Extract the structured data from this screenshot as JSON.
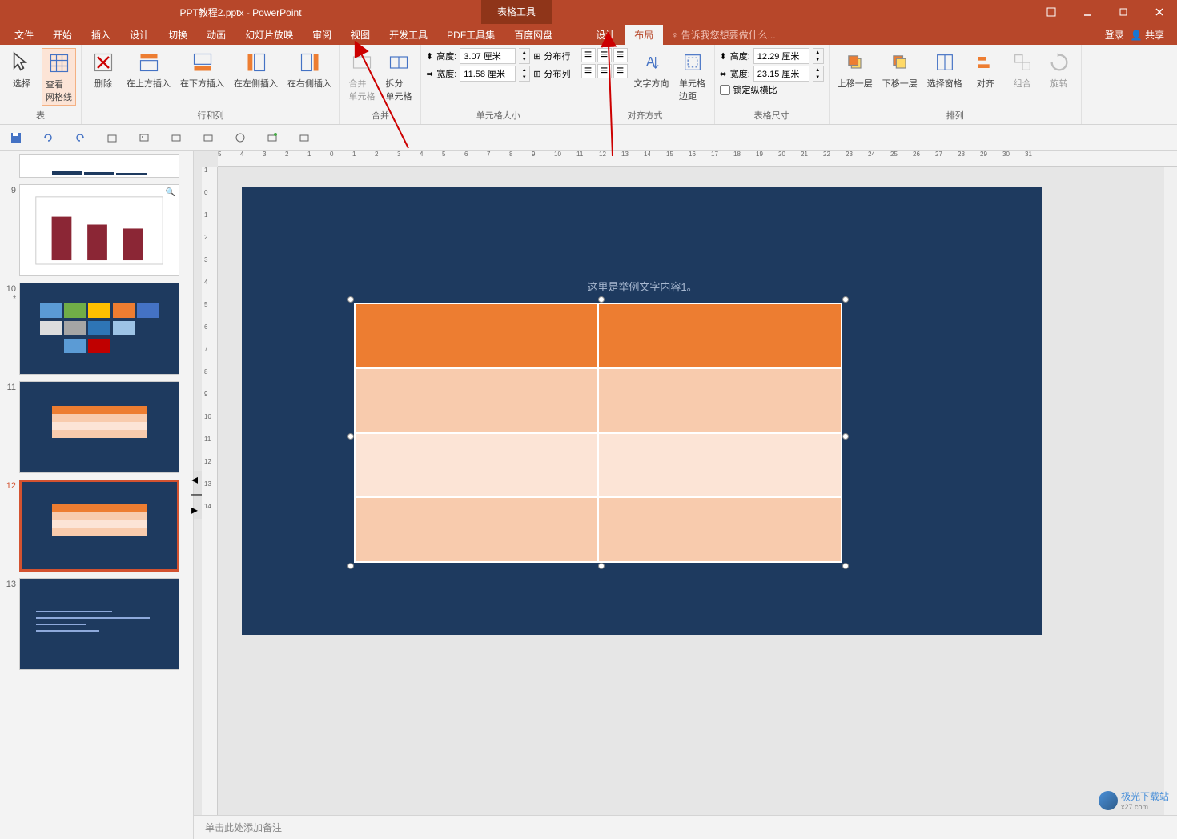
{
  "title": "PPT教程2.pptx - PowerPoint",
  "table_tools": "表格工具",
  "menu": {
    "file": "文件",
    "home": "开始",
    "insert": "插入",
    "design": "设计",
    "transitions": "切换",
    "animations": "动画",
    "slideshow": "幻灯片放映",
    "review": "审阅",
    "view": "视图",
    "developer": "开发工具",
    "pdf": "PDF工具集",
    "baidu": "百度网盘",
    "tbl_design": "设计",
    "tbl_layout": "布局"
  },
  "tell_me": "告诉我您想要做什么...",
  "right": {
    "login": "登录",
    "share": "共享"
  },
  "ribbon": {
    "select": "选择",
    "view_gridlines": "查看\n网格线",
    "table_group": "表",
    "delete": "删除",
    "insert_above": "在上方插入",
    "insert_below": "在下方插入",
    "insert_left": "在左侧插入",
    "insert_right": "在右侧插入",
    "rows_cols_group": "行和列",
    "merge_cells": "合并\n单元格",
    "split_cells": "拆分\n单元格",
    "merge_group": "合并",
    "height_label": "高度:",
    "width_label": "宽度:",
    "cell_height": "3.07 厘米",
    "cell_width": "11.58 厘米",
    "distribute_rows": "分布行",
    "distribute_cols": "分布列",
    "cell_size_group": "单元格大小",
    "text_direction": "文字方向",
    "cell_margins": "单元格\n边距",
    "alignment_group": "对齐方式",
    "table_height": "12.29 厘米",
    "table_width": "23.15 厘米",
    "lock_ratio": "锁定纵横比",
    "table_size_group": "表格尺寸",
    "bring_forward": "上移一层",
    "send_backward": "下移一层",
    "selection_pane": "选择窗格",
    "align": "对齐",
    "group": "组合",
    "rotate": "旋转",
    "arrange_group": "排列"
  },
  "slides": {
    "s9": "9",
    "s10": "10",
    "s11": "11",
    "s12": "12",
    "s13": "13"
  },
  "slide_content": {
    "title": "这里是举例文字内容1。"
  },
  "notes": "单击此处添加备注",
  "watermark": "极光下载站",
  "watermark_url": "x27.com",
  "ruler_h": [
    "5",
    "4",
    "3",
    "2",
    "1",
    "0",
    "1",
    "2",
    "3",
    "4",
    "5",
    "6",
    "7",
    "8",
    "9",
    "10",
    "11",
    "12",
    "13",
    "14",
    "15",
    "16",
    "17",
    "18",
    "19",
    "20",
    "21",
    "22",
    "23",
    "24",
    "25",
    "26",
    "27",
    "28",
    "29",
    "30",
    "31"
  ],
  "ruler_v": [
    "1",
    "0",
    "1",
    "2",
    "3",
    "4",
    "5",
    "6",
    "7",
    "8",
    "9",
    "10",
    "11",
    "12",
    "13",
    "14"
  ]
}
